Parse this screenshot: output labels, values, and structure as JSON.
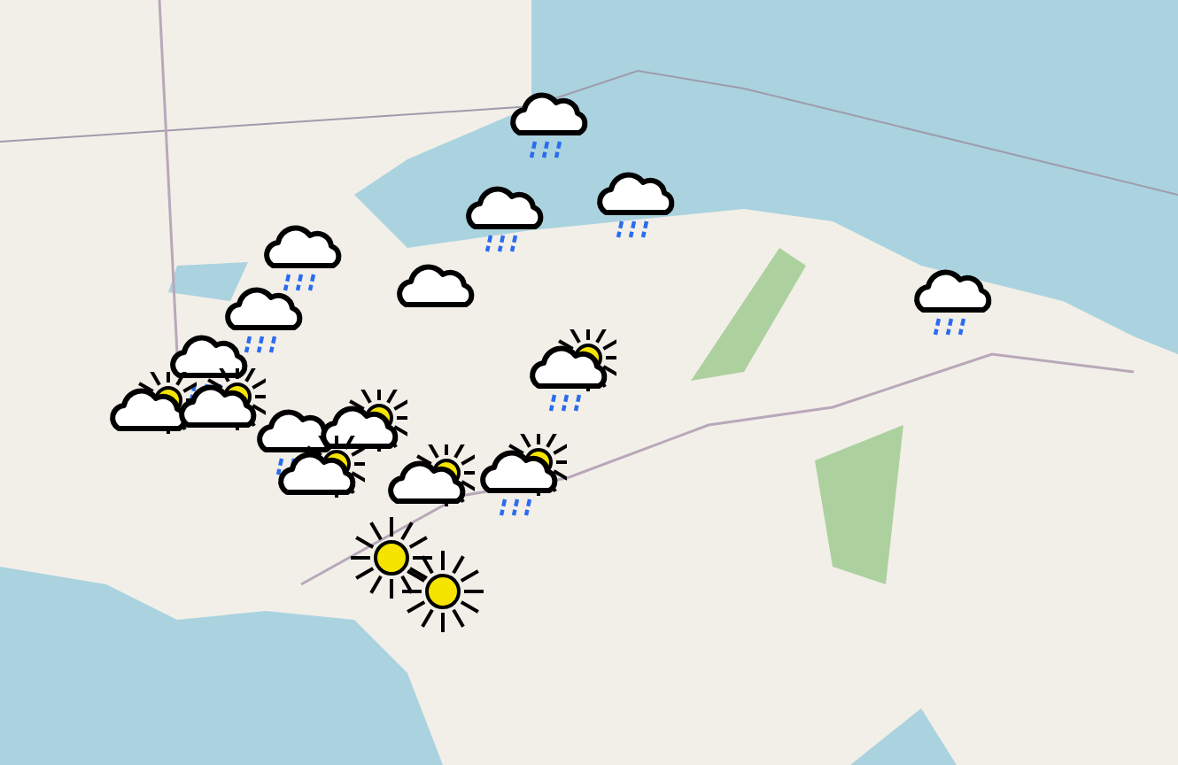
{
  "map": {
    "markers": [
      {
        "kind": "rain"
      },
      {
        "kind": "rain"
      },
      {
        "kind": "rain"
      },
      {
        "kind": "rain"
      },
      {
        "kind": "cloud"
      },
      {
        "kind": "rain"
      },
      {
        "kind": "rain"
      },
      {
        "kind": "partly-rain"
      },
      {
        "kind": "rain"
      },
      {
        "kind": "partly"
      },
      {
        "kind": "partly"
      },
      {
        "kind": "rain"
      },
      {
        "kind": "partly"
      },
      {
        "kind": "partly"
      },
      {
        "kind": "partly"
      },
      {
        "kind": "partly-rain"
      },
      {
        "kind": "sun"
      },
      {
        "kind": "sun"
      }
    ]
  }
}
